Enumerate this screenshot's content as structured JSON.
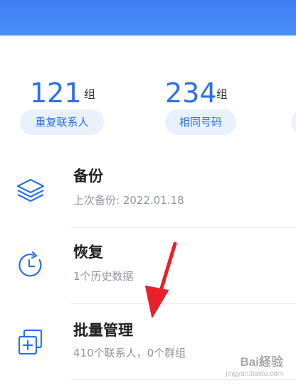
{
  "stats": [
    {
      "count": "121",
      "unit": "组",
      "label": "重复联系人"
    },
    {
      "count": "234",
      "unit": "组",
      "label": "相同号码"
    }
  ],
  "menu": [
    {
      "title": "备份",
      "subtitle": "上次备份: 2022.01.18",
      "icon": "layers-icon"
    },
    {
      "title": "恢复",
      "subtitle": "1个历史数据",
      "icon": "clock-restore-icon"
    },
    {
      "title": "批量管理",
      "subtitle": "410个联系人，0个群组",
      "icon": "add-copy-icon"
    }
  ],
  "colors": {
    "accent": "#2d6fe6",
    "header": "#4a8ff7",
    "pill_bg": "#e9f1fd",
    "annotation": "#e8202a"
  },
  "watermark": {
    "main": "Bai経验",
    "sub": "jingyan.baidu.com"
  }
}
